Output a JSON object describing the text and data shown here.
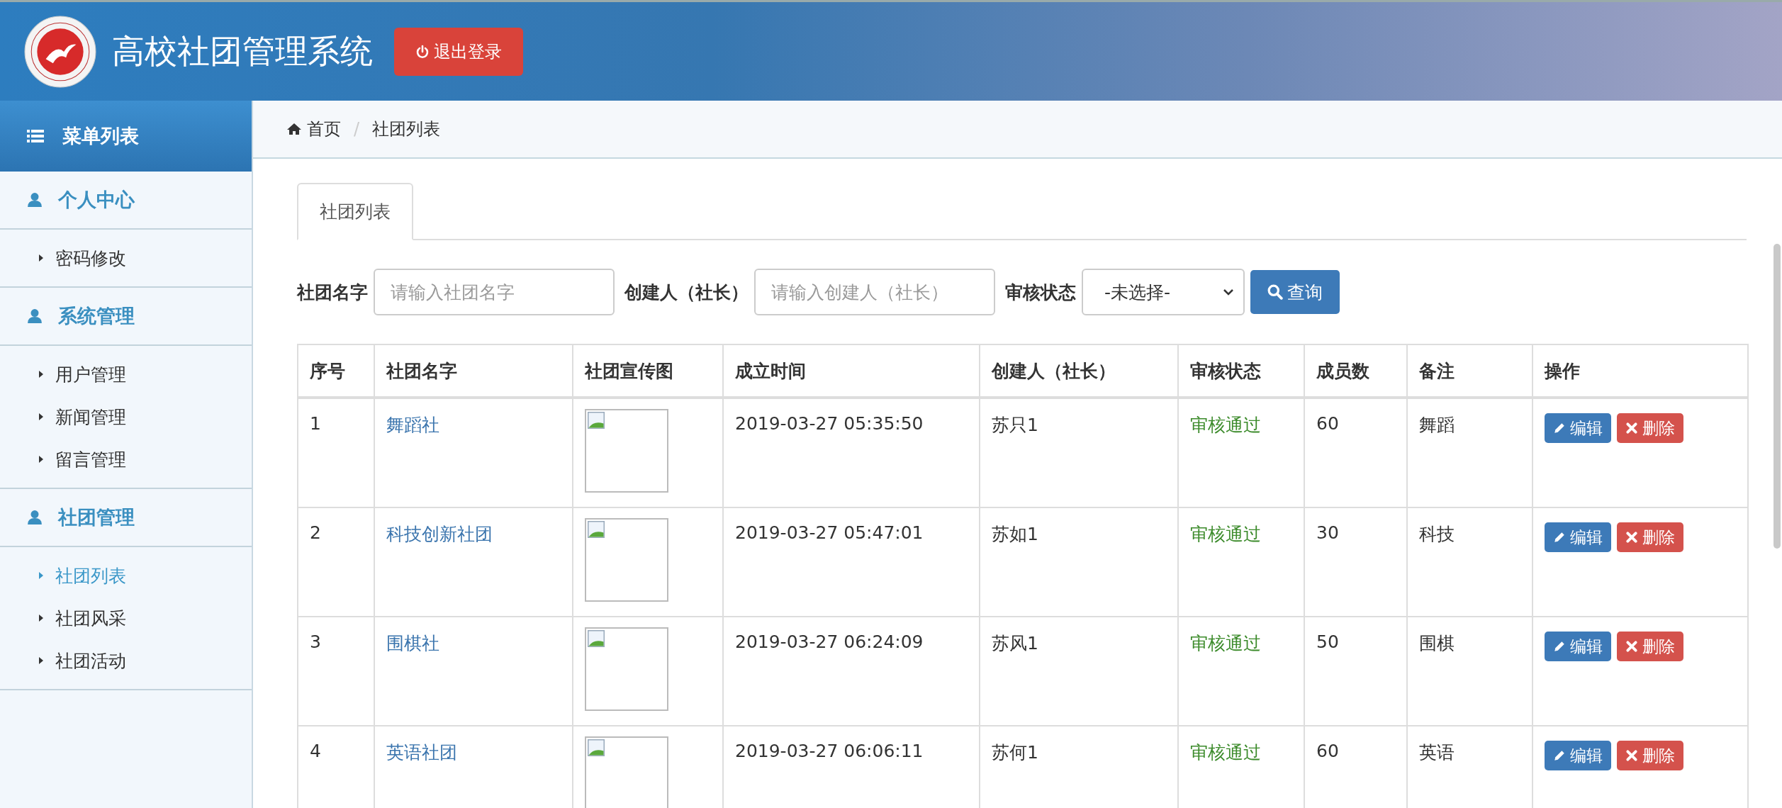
{
  "header": {
    "title": "高校社团管理系统",
    "logout_button": "退出登录"
  },
  "sidebar": {
    "title": "菜单列表",
    "groups": [
      {
        "label": "个人中心",
        "items": [
          {
            "label": "密码修改",
            "selected": false
          }
        ]
      },
      {
        "label": "系统管理",
        "items": [
          {
            "label": "用户管理",
            "selected": false
          },
          {
            "label": "新闻管理",
            "selected": false
          },
          {
            "label": "留言管理",
            "selected": false
          }
        ]
      },
      {
        "label": "社团管理",
        "items": [
          {
            "label": "社团列表",
            "selected": true
          },
          {
            "label": "社团风采",
            "selected": false
          },
          {
            "label": "社团活动",
            "selected": false
          }
        ]
      }
    ]
  },
  "breadcrumb": {
    "separator": "/",
    "items": [
      "首页",
      "社团列表"
    ]
  },
  "tabs": [
    {
      "label": "社团列表",
      "selected": true
    }
  ],
  "search": {
    "fields": [
      {
        "label": "社团名字",
        "kind": "text",
        "placeholder": "请输入社团名字"
      },
      {
        "label": "创建人（社长）",
        "kind": "text",
        "placeholder": "请输入创建人（社长）"
      },
      {
        "label": "审核状态",
        "kind": "select",
        "value": "-未选择-"
      }
    ],
    "button": "查询"
  },
  "table": {
    "columns": [
      "序号",
      "社团名字",
      "社团宣传图",
      "成立时间",
      "创建人（社长）",
      "审核状态",
      "成员数",
      "备注",
      "操作"
    ],
    "rows": [
      {
        "no": "1",
        "name": "舞蹈社",
        "founded": "2019-03-27 05:35:50",
        "creator": "苏只1",
        "status": "审核通过",
        "members": "60",
        "note": "舞蹈",
        "actions": [
          "编辑",
          "删除"
        ]
      },
      {
        "no": "2",
        "name": "科技创新社团",
        "founded": "2019-03-27 05:47:01",
        "creator": "苏如1",
        "status": "审核通过",
        "members": "30",
        "note": "科技",
        "actions": [
          "编辑",
          "删除"
        ]
      },
      {
        "no": "3",
        "name": "围棋社",
        "founded": "2019-03-27 06:24:09",
        "creator": "苏风1",
        "status": "审核通过",
        "members": "50",
        "note": "围棋",
        "actions": [
          "编辑",
          "删除"
        ]
      },
      {
        "no": "4",
        "name": "英语社团",
        "founded": "2019-03-27 06:06:11",
        "creator": "苏何1",
        "status": "审核通过",
        "members": "60",
        "note": "英语",
        "actions": [
          "编辑",
          "删除"
        ]
      }
    ]
  }
}
